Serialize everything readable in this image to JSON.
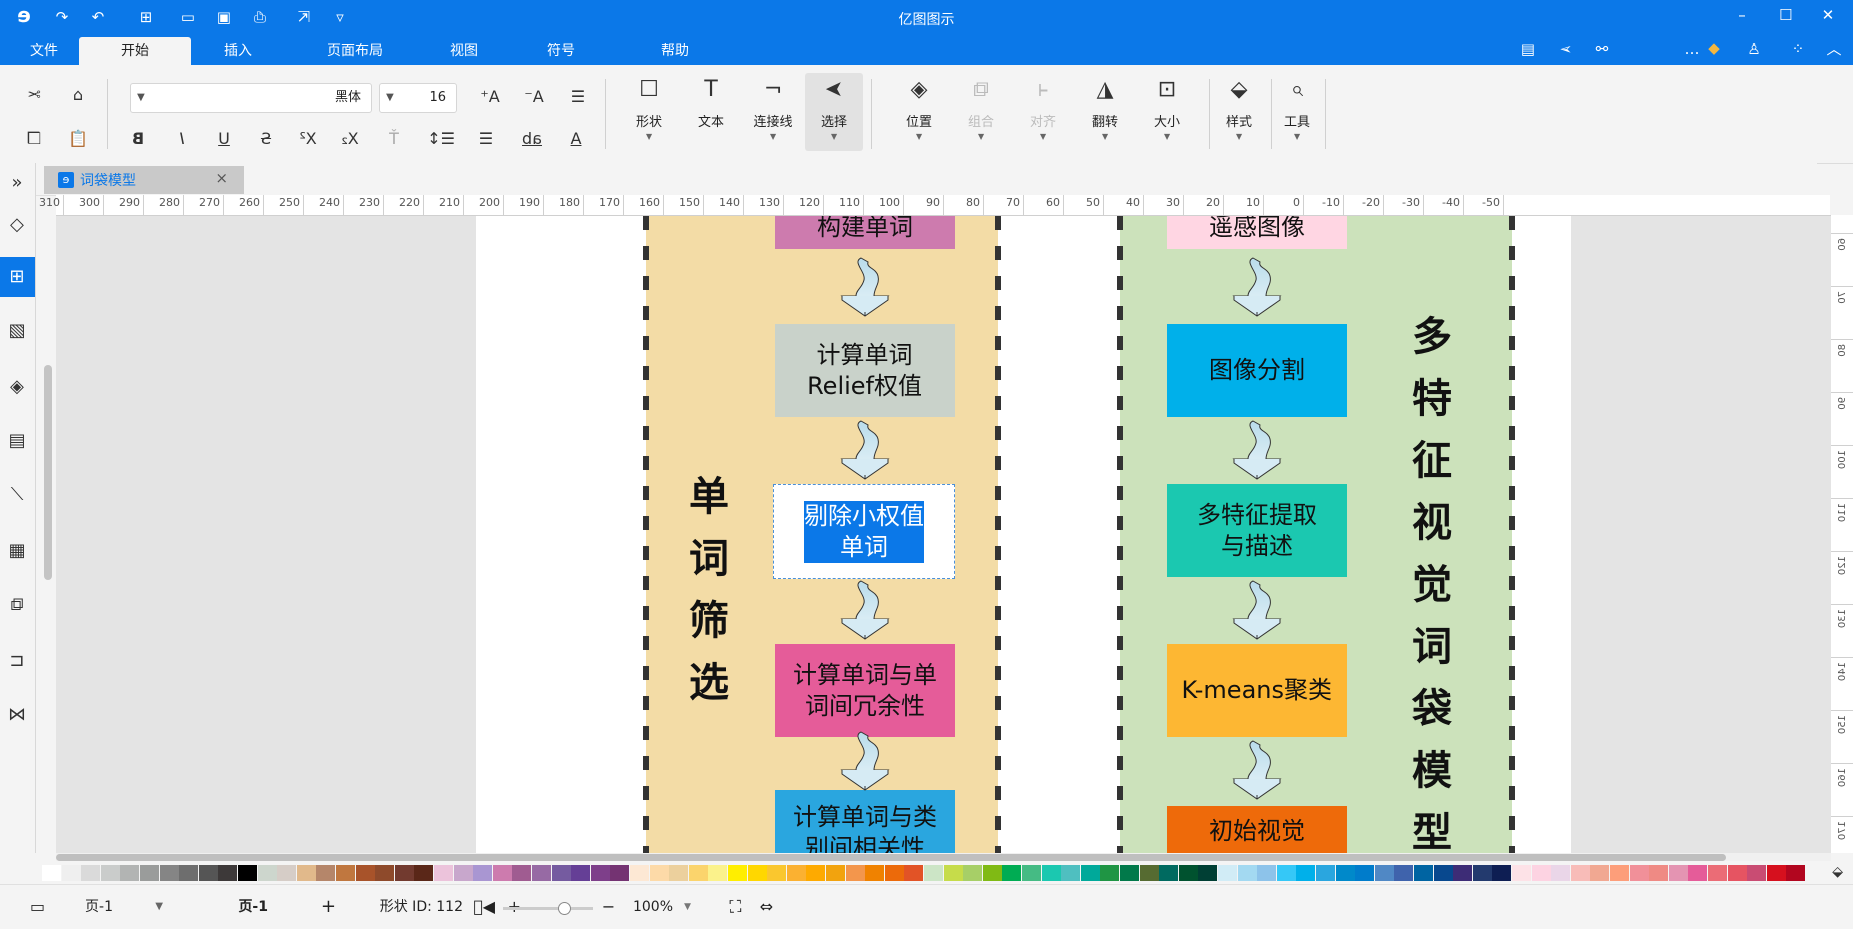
{
  "app": {
    "title": "亿图图示",
    "logo_icon": "edraw-logo-icon"
  },
  "quick_access": {
    "undo_icon": "undo-icon",
    "redo_icon": "redo-icon",
    "new_icon": "new-file-icon",
    "open_icon": "open-folder-icon",
    "save_icon": "save-icon",
    "print_icon": "print-icon",
    "export_icon": "export-icon",
    "more_icon": "customize-icon"
  },
  "window_controls": {
    "minimize": "minimize-icon",
    "maximize": "maximize-icon",
    "close": "close-icon"
  },
  "ribbon_tabs": [
    {
      "label": "文件",
      "active": false
    },
    {
      "label": "开始",
      "active": true
    },
    {
      "label": "插入",
      "active": false
    },
    {
      "label": "页面布局",
      "active": false
    },
    {
      "label": "视图",
      "active": false
    },
    {
      "label": "符号",
      "active": false
    },
    {
      "label": "帮助",
      "active": false
    }
  ],
  "font": {
    "family": "黑体",
    "size": "16"
  },
  "ribbon_groups": {
    "clipboard": [
      "cut-icon",
      "copy-icon",
      "paste-icon",
      "format-painter-icon"
    ],
    "text_format": [
      "bold-icon",
      "italic-icon",
      "underline-icon",
      "strikethrough-icon",
      "superscript-icon",
      "subscript-icon",
      "text-effect-icon",
      "line-spacing-icon",
      "list-icon",
      "highlight-icon",
      "font-color-icon",
      "grow-font-icon",
      "shrink-font-icon",
      "align-icon"
    ],
    "big_buttons": [
      {
        "label": "形状",
        "icon": "shape-icon",
        "disabled": false,
        "selected": false
      },
      {
        "label": "文本",
        "icon": "text-icon",
        "disabled": false,
        "selected": false
      },
      {
        "label": "连接线",
        "icon": "connector-icon",
        "disabled": false,
        "selected": false
      },
      {
        "label": "选择",
        "icon": "select-arrow-icon",
        "disabled": false,
        "selected": true
      },
      {
        "label": "位置",
        "icon": "layers-icon",
        "disabled": false,
        "selected": false
      },
      {
        "label": "组合",
        "icon": "group-icon",
        "disabled": true,
        "selected": false
      },
      {
        "label": "对齐",
        "icon": "align-objects-icon",
        "disabled": true,
        "selected": false
      },
      {
        "label": "翻转",
        "icon": "flip-icon",
        "disabled": false,
        "selected": false
      },
      {
        "label": "大小",
        "icon": "size-icon",
        "disabled": false,
        "selected": false
      },
      {
        "label": "样式",
        "icon": "style-bucket-icon",
        "disabled": false,
        "selected": false
      },
      {
        "label": "工具",
        "icon": "tools-icon",
        "disabled": false,
        "selected": false
      }
    ]
  },
  "document_tab": {
    "name": "词袋模型",
    "close": "×"
  },
  "left_sidebar": [
    "expand-icon",
    "fill-icon",
    "symbol-library-icon",
    "image-icon",
    "layers-icon",
    "page-icon",
    "chart-icon",
    "table-icon",
    "puzzle-icon",
    "outline-icon",
    "mindmap-icon"
  ],
  "ruler": {
    "horizontal": [
      "-50",
      "-40",
      "-30",
      "-20",
      "-10",
      "0",
      "10",
      "20",
      "30",
      "40",
      "50",
      "60",
      "70",
      "80",
      "90",
      "100",
      "110",
      "120",
      "130",
      "140",
      "150",
      "160",
      "170",
      "180",
      "190",
      "200",
      "210",
      "220",
      "230",
      "240",
      "250",
      "260",
      "270",
      "280",
      "290",
      "300",
      "310"
    ],
    "vertical": [
      "60",
      "70",
      "80",
      "90",
      "100",
      "110",
      "120",
      "130",
      "140",
      "150",
      "160",
      "170"
    ]
  },
  "diagram": {
    "right_lane": {
      "title": "单\n词\n筛\n选",
      "color": "#f3dca6",
      "boxes": [
        {
          "text": "构建单词",
          "color": "#cd7bae"
        },
        {
          "text": "计算单词\nRelief权值",
          "color": "#c9d2ca"
        },
        {
          "text": "剔除小权值\n单词",
          "color": "#ffffff",
          "editing": true
        },
        {
          "text": "计算单词与单\n词间冗余性",
          "color": "#e55c99"
        },
        {
          "text": "计算单词与类\n别间相关性",
          "color": "#2aa6df"
        }
      ]
    },
    "left_lane": {
      "title": "多\n特\n征\n视\n觉\n词\n袋\n模\n型",
      "color": "#cce2bb",
      "boxes": [
        {
          "text": "遥感图像",
          "color": "#ffd6e3"
        },
        {
          "text": "图像分割",
          "color": "#00b0ea"
        },
        {
          "text": "多特征提取\n与描述",
          "color": "#1bc8b0"
        },
        {
          "text": "K-means聚类",
          "color": "#fdb733"
        },
        {
          "text": "初始视觉",
          "color": "#ee6a0a"
        }
      ]
    }
  },
  "palette": [
    "#ffffff",
    "#efefef",
    "#dadada",
    "#cacccb",
    "#b2b4b3",
    "#9a9c9b",
    "#858585",
    "#6e6e6e",
    "#555555",
    "#3d3939",
    "#000000",
    "#cdd6cd",
    "#d6cdc7",
    "#e1b98b",
    "#b5866a",
    "#c0773f",
    "#a8532a",
    "#8e4a2b",
    "#723a2f",
    "#5a2718",
    "#ecc3db",
    "#c8a7cc",
    "#a996d2",
    "#cd7bae",
    "#a05c91",
    "#976aa4",
    "#755ba0",
    "#653f96",
    "#7e3f8a",
    "#743372",
    "#fde8d4",
    "#fddaa8",
    "#ecd09d",
    "#fbd46c",
    "#fbf28b",
    "#ffee00",
    "#ffd700",
    "#fac72e",
    "#fbb131",
    "#feaa00",
    "#f2a30e",
    "#f3964c",
    "#f08200",
    "#ec6a0a",
    "#e25326",
    "#cce5c6",
    "#c6dc4a",
    "#a7cf67",
    "#80ba14",
    "#00ac53",
    "#45bb84",
    "#1bc8b0",
    "#4fbfc0",
    "#00a99a",
    "#1f9544",
    "#01794a",
    "#566b31",
    "#006a60",
    "#00522f",
    "#003f34",
    "#d1ecf6",
    "#a3d9f1",
    "#8dc3ea",
    "#35c8f7",
    "#00b0ea",
    "#2aa6df",
    "#0089ca",
    "#007ccb",
    "#5088c5",
    "#3f63ac",
    "#0064a2",
    "#08488e",
    "#3d2c76",
    "#233a6e",
    "#0e1e53",
    "#fde2e7",
    "#fdd3e2",
    "#ead6e8",
    "#f8bcb8",
    "#f1a892",
    "#fd9e7a",
    "#f19099",
    "#ef8a84",
    "#e494b2",
    "#e55c99",
    "#eb6c76",
    "#e65462",
    "#c94c73",
    "#d6101e",
    "#b2061f"
  ],
  "status": {
    "shape_id_label": "形状 ID:",
    "shape_id": "112",
    "zoom": "100%",
    "page_label": "页-1",
    "page_tab": "页-1",
    "add_page": "+"
  }
}
